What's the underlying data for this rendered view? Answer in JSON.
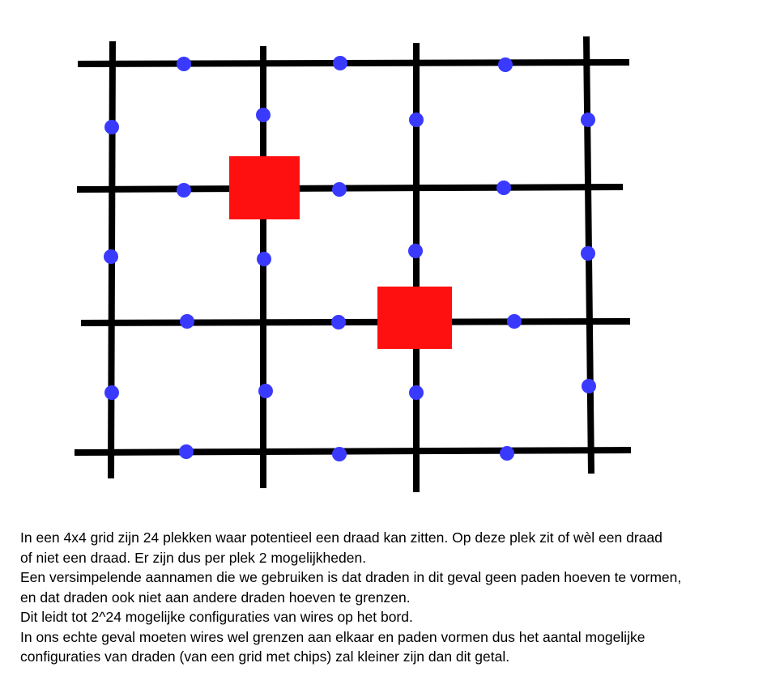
{
  "figure": {
    "grid_size": "4x4",
    "colors": {
      "grid_line": "#000000",
      "chip": "#ff1010",
      "wire_slot": "#3a3aff",
      "background": "#ffffff"
    },
    "chip_count": 2,
    "wire_slot_count": 24
  },
  "description": {
    "lines": [
      "In een 4x4 grid zijn 24 plekken waar potentieel een draad kan zitten. Op deze plek zit of wèl een draad",
      "of niet een draad. Er zijn dus per plek 2 mogelijkheden.",
      "Een versimpelende aannamen die we gebruiken is dat draden in dit geval geen paden hoeven te vormen,",
      "en dat draden ook niet aan andere draden hoeven te grenzen.",
      "Dit leidt tot 2^24 mogelijke configuraties van wires op het bord.",
      "In ons echte geval moeten wires wel grenzen aan elkaar en paden vormen dus het aantal mogelijke",
      "configuraties van draden (van een grid met chips) zal kleiner zijn dan dit getal."
    ]
  }
}
